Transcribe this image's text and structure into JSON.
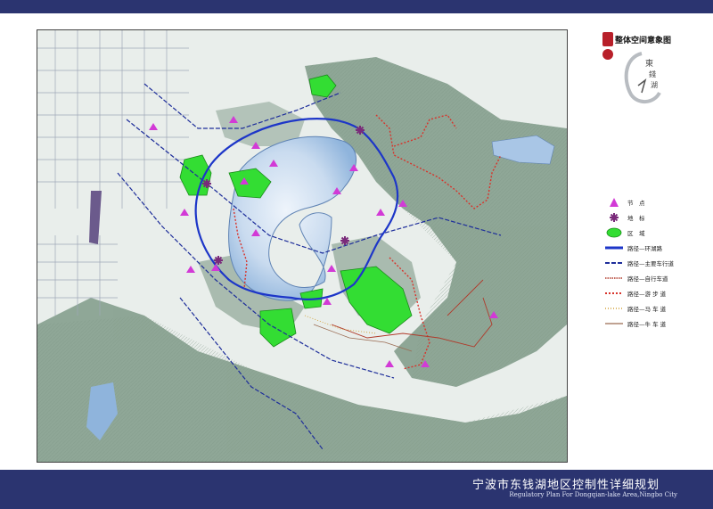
{
  "map_title": "整体空间意象图",
  "footer": {
    "title": "宁波市东钱湖地区控制性详细规划",
    "subtitle": "Regulatory Plan For Dongqian-lake Area,Ningbo City"
  },
  "colors": {
    "frame_bar": "#2b3470",
    "lake": "#c9dbef",
    "green_area": "#33dd33",
    "node": "#d23ad6",
    "landmark": "#7a2a7a",
    "ring_road": "#1d36c8",
    "main_road": "#1d2d9a",
    "bike_path": "#b03a2a",
    "walk_path": "#d8332b",
    "horse_path": "#d2a23a",
    "cart_path": "#9a6b52"
  },
  "legend": [
    {
      "symbol": "node-icon",
      "label": "节　点"
    },
    {
      "symbol": "landmark-icon",
      "label": "地　标"
    },
    {
      "symbol": "area-icon",
      "label": "区　域"
    },
    {
      "symbol": "ring-road-line",
      "label": "路径—环湖路"
    },
    {
      "symbol": "main-road-line",
      "label": "路径—主要车行道"
    },
    {
      "symbol": "bike-path-line",
      "label": "路径—自行车道"
    },
    {
      "symbol": "walk-path-line",
      "label": "路径—游 步 道"
    },
    {
      "symbol": "horse-path-line",
      "label": "路径—马 车 道"
    },
    {
      "symbol": "cart-path-line",
      "label": "路径—牛 车 道"
    }
  ]
}
